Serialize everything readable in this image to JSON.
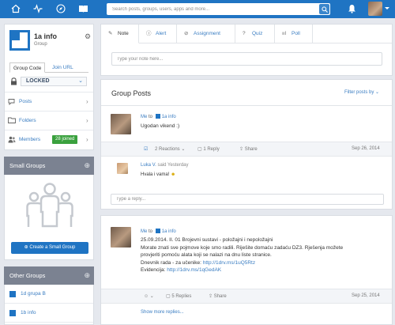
{
  "app": {
    "brand_color": "#1f74c3",
    "nav_icons": [
      "home-icon",
      "activity-icon",
      "compass-icon",
      "book-icon"
    ],
    "search_placeholder": "Search posts, groups, users, apps and more...",
    "bell_icon": "bell-icon"
  },
  "group": {
    "name": "1a info",
    "type": "Group",
    "tabs": [
      "Group Code",
      "Join URL"
    ],
    "lock_status": "LOCKED",
    "nav": [
      {
        "label": "Posts",
        "icon": "chat-bubble-icon"
      },
      {
        "label": "Folders",
        "icon": "folder-icon"
      },
      {
        "label": "Members",
        "icon": "members-icon",
        "badge": "28 joined"
      }
    ]
  },
  "small_groups": {
    "title": "Small Groups",
    "create_label": "Create a Small Group"
  },
  "other_groups": {
    "title": "Other Groups",
    "items": [
      "1d grupa B",
      "1b info"
    ]
  },
  "composer": {
    "tabs": [
      "Note",
      "Alert",
      "Assignment",
      "Quiz",
      "Poll"
    ],
    "active_tab": "Note",
    "placeholder": "Type your note here..."
  },
  "feed": {
    "title": "Group Posts",
    "filter_label": "Filter posts by",
    "posts": [
      {
        "author": "Me",
        "to": "to",
        "group": "1a info",
        "lines": [
          "Ugodan vikend :)"
        ],
        "reactions": "2 Reactions",
        "replies": "1 Reply",
        "share": "Share",
        "date": "Sep 26, 2014",
        "comment": {
          "author": "Luka V.",
          "said": "said Yesterday",
          "text": "Hvala i vama!"
        },
        "reply_placeholder": "Type a reply..."
      },
      {
        "author": "Me",
        "to": "to",
        "group": "1a info",
        "lines": [
          "25.09.2014. II. 01 Brojevni sustavi - položajni i nepoložajni",
          "Morate znati sve pojmove koje smo radili. Riješite domaću zadaću DZ3. Rješenja možete",
          "provjeriti pomoću alata koji se nalazi na dnu liste stranice."
        ],
        "link1_prefix": "Dnevnik rada - za učenike: ",
        "link1": "http://1drv.ms/1uQ5Rtz",
        "link2_prefix": "Evidencija: ",
        "link2": "http://1drv.ms/1qGedAK",
        "replies": "5 Replies",
        "share": "Share",
        "date": "Sep 25, 2014",
        "show_more": "Show more replies..."
      }
    ]
  }
}
